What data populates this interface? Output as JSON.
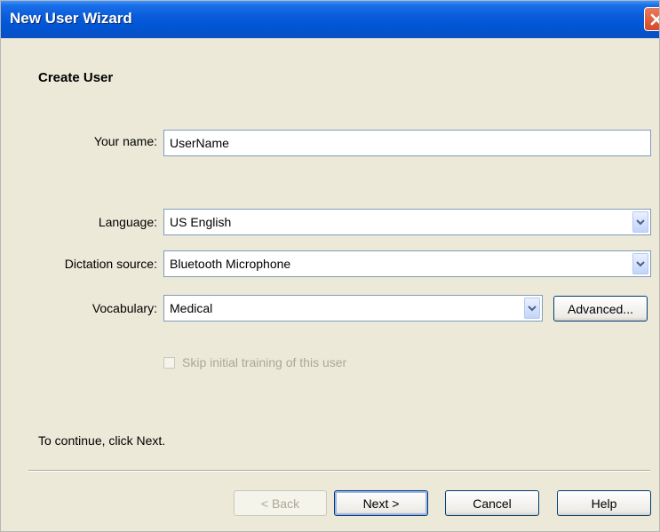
{
  "window": {
    "title": "New User Wizard"
  },
  "page": {
    "heading": "Create User",
    "hint": "To continue, click Next."
  },
  "form": {
    "name_label": "Your name:",
    "name_value": "UserName",
    "language_label": "Language:",
    "language_value": "US English",
    "dictation_label": "Dictation source:",
    "dictation_value": "Bluetooth Microphone",
    "vocabulary_label": "Vocabulary:",
    "vocabulary_value": "Medical",
    "advanced_label": "Advanced...",
    "skip_training_label": "Skip initial training of this user",
    "skip_training_checked": false,
    "skip_training_enabled": false
  },
  "buttons": {
    "back": "< Back",
    "next": "Next >",
    "cancel": "Cancel",
    "help": "Help"
  },
  "icons": {
    "close": "close-icon",
    "dropdown": "chevron-down-icon"
  },
  "colors": {
    "titlebar": "#0055d4",
    "dialog_bg": "#ece9d8",
    "close_button": "#d54a25",
    "input_border": "#7f9db9",
    "disabled_text": "#aca899"
  }
}
